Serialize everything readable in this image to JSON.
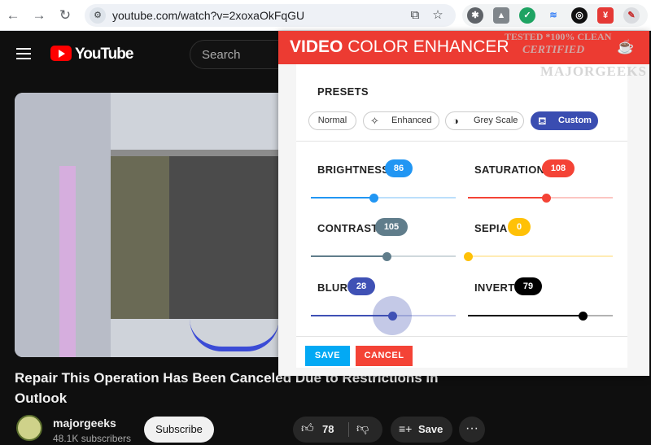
{
  "browser": {
    "url": "youtube.com/watch?v=2xoxaOkFqGU",
    "nav_icons": [
      "back-icon",
      "forward-icon",
      "reload-icon"
    ],
    "extensions": [
      "ext-chrome-icon",
      "ext-shield-icon",
      "ext-check-icon",
      "ext-audio-icon",
      "ext-target-icon",
      "ext-red-icon",
      "ext-magic-icon"
    ]
  },
  "youtube": {
    "logo": "YouTube",
    "search_placeholder": "Search",
    "video_title": "Repair This Operation Has Been Canceled Due to Restrictions in Outlook",
    "channel": "majorgeeks",
    "subscribers": "48.1K subscribers",
    "subscribe_label": "Subscribe",
    "likes": "78",
    "save_label": "Save",
    "more_label": "···"
  },
  "extension": {
    "title_bold": "VIDEO",
    "title_rest": " COLOR ENHANCER",
    "presets_label": "PRESETS",
    "presets": [
      {
        "label": "Normal",
        "icon": "",
        "active": false
      },
      {
        "label": "Enhanced",
        "icon": "magic-wand-icon",
        "active": false
      },
      {
        "label": "Grey Scale",
        "icon": "contrast-icon",
        "active": false
      },
      {
        "label": "Custom",
        "icon": "paint-bucket-icon",
        "active": true
      }
    ],
    "controls": [
      {
        "label": "BRIGHTNESS",
        "value": "86",
        "color": "#2196f3",
        "level": 0.43
      },
      {
        "label": "SATURATION",
        "value": "108",
        "color": "#f44336",
        "level": 0.54
      },
      {
        "label": "CONTRAST",
        "value": "105",
        "color": "#607d8b",
        "level": 0.52
      },
      {
        "label": "SEPIA",
        "value": "0",
        "color": "#ffc107",
        "level": 0.0
      },
      {
        "label": "BLUR",
        "value": "28",
        "color": "#3f51b5",
        "level": 0.56
      },
      {
        "label": "INVERT",
        "value": "79",
        "color": "#000000",
        "level": 0.79
      }
    ],
    "save_label": "SAVE",
    "cancel_label": "CANCEL"
  },
  "watermark": {
    "line1": "TESTED *100% CLEAN",
    "line2": "CERTIFIED",
    "line3": "MAJORGEEKS"
  }
}
